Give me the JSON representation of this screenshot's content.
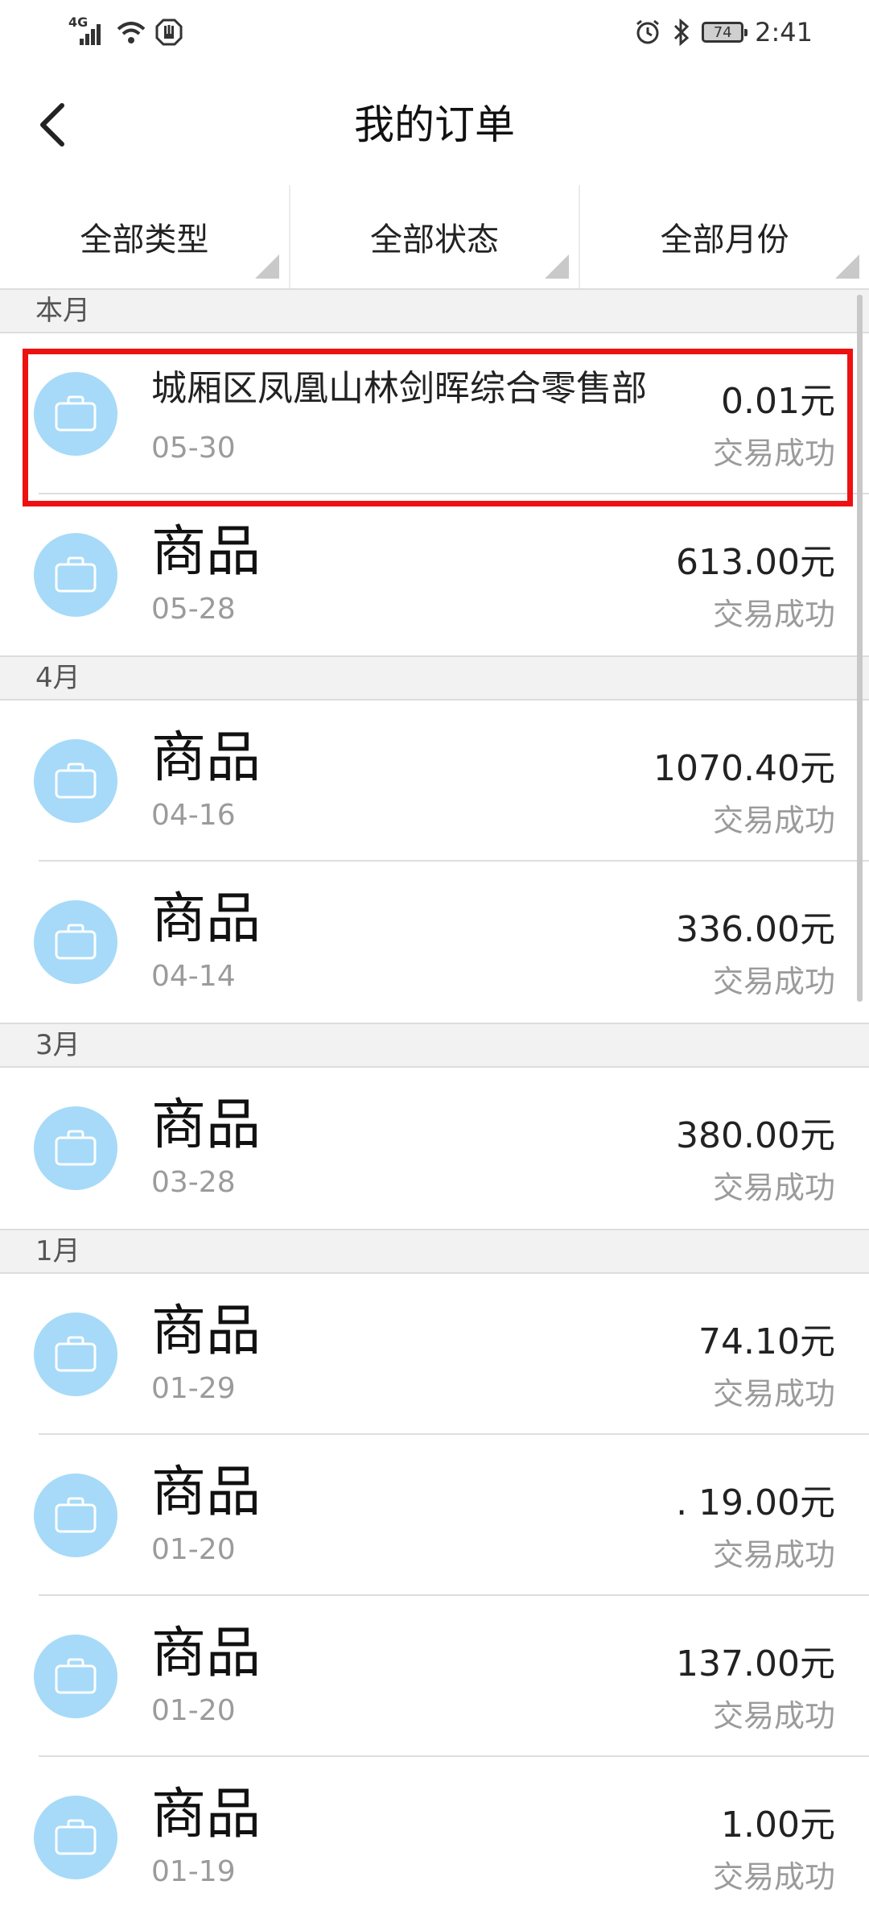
{
  "status_bar": {
    "network": "4G",
    "battery": "74",
    "time": "2:41"
  },
  "header": {
    "title": "我的订单"
  },
  "filters": [
    {
      "label": "全部类型"
    },
    {
      "label": "全部状态"
    },
    {
      "label": "全部月份"
    }
  ],
  "sections": [
    {
      "label": "本月",
      "orders": [
        {
          "name": "城厢区凤凰山林剑晖综合零售部",
          "date": "05-30",
          "amount": "0.01元",
          "status": "交易成功"
        },
        {
          "name": "商品",
          "date": "05-28",
          "amount": "613.00元",
          "status": "交易成功"
        }
      ]
    },
    {
      "label": "4月",
      "orders": [
        {
          "name": "商品",
          "date": "04-16",
          "amount": "1070.40元",
          "status": "交易成功"
        },
        {
          "name": "商品",
          "date": "04-14",
          "amount": "336.00元",
          "status": "交易成功"
        }
      ]
    },
    {
      "label": "3月",
      "orders": [
        {
          "name": "商品",
          "date": "03-28",
          "amount": "380.00元",
          "status": "交易成功"
        }
      ]
    },
    {
      "label": "1月",
      "orders": [
        {
          "name": "商品",
          "date": "01-29",
          "amount": "74.10元",
          "status": "交易成功"
        },
        {
          "name": "商品",
          "date": "01-20",
          "amount": ". 19.00元",
          "status": "交易成功"
        },
        {
          "name": "商品",
          "date": "01-20",
          "amount": "137.00元",
          "status": "交易成功"
        },
        {
          "name": "商品",
          "date": "01-19",
          "amount": "1.00元",
          "status": "交易成功"
        }
      ]
    }
  ],
  "colors": {
    "icon_bg": "#a6daf8",
    "highlight": "#ee1111"
  },
  "icons": {
    "back": "chevron-left-icon",
    "order": "shopping-bag-icon"
  }
}
